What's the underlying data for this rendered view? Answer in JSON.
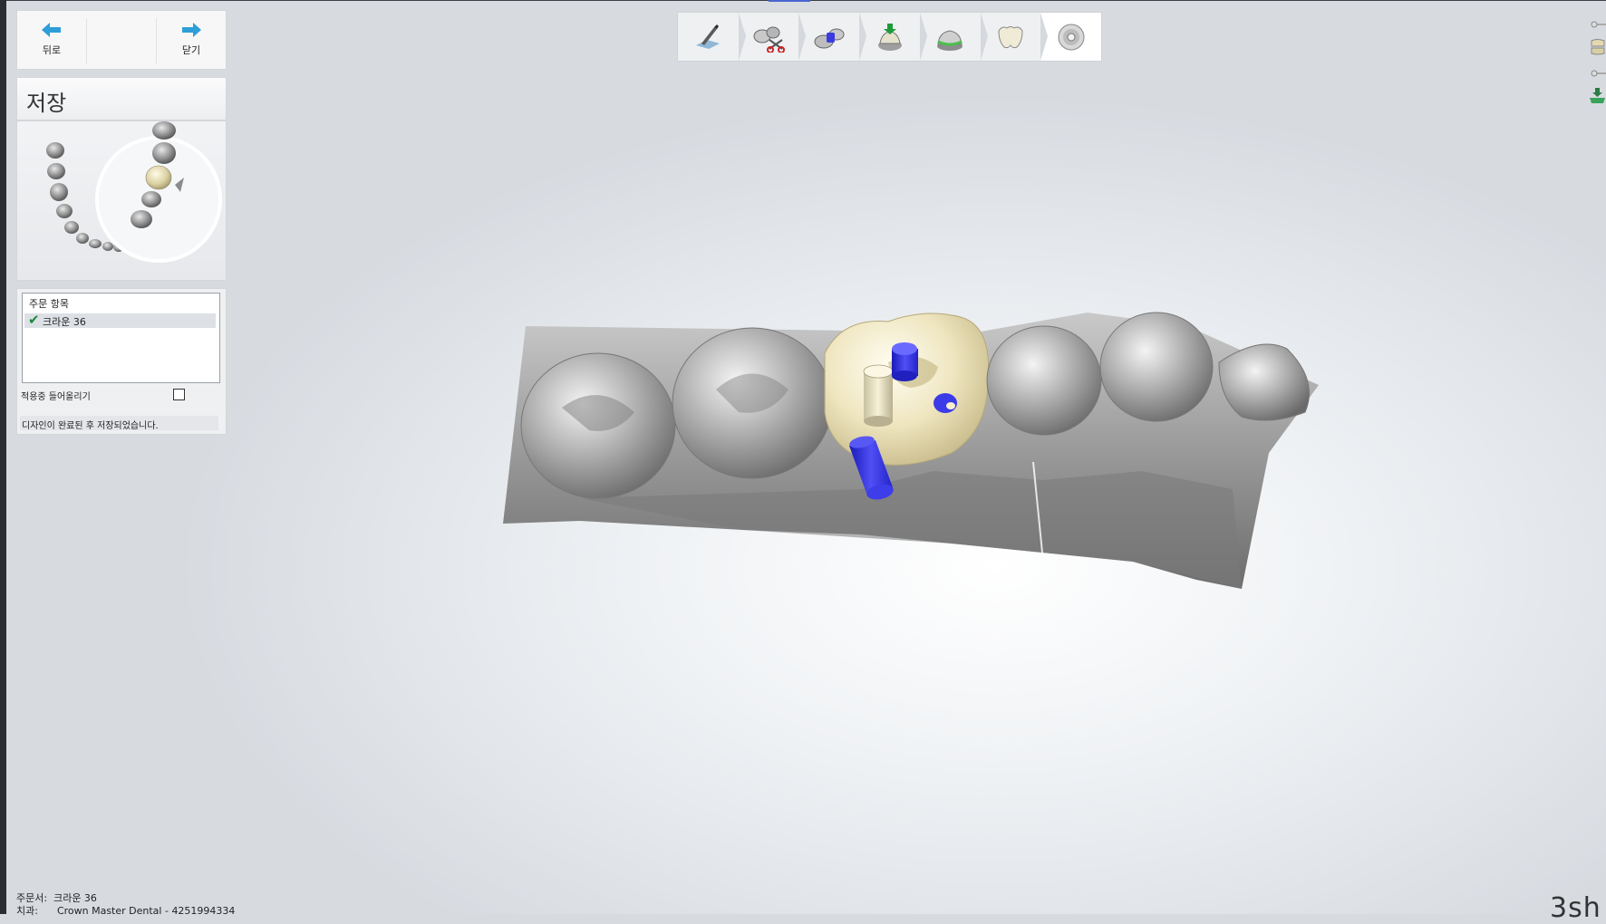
{
  "nav": {
    "back_label": "뒤로",
    "close_label": "닫기"
  },
  "step": {
    "title": "저장"
  },
  "order_panel": {
    "header": "주문 항목",
    "items": [
      {
        "label": "크라운 36",
        "checked": true
      }
    ],
    "option_label": "적용중 들어올리기",
    "option_checked": false,
    "status": "디자인이 완료된 후 저장되었습니다."
  },
  "toolbar": {
    "steps": [
      {
        "icon": "prepare-margin-icon"
      },
      {
        "icon": "scissors-trim-icon"
      },
      {
        "icon": "attachment-blocks-icon"
      },
      {
        "icon": "insertion-direction-icon"
      },
      {
        "icon": "cement-gap-icon"
      },
      {
        "icon": "crown-tooth-icon"
      },
      {
        "icon": "save-disc-icon",
        "active": true
      }
    ]
  },
  "right_icons": [
    "slider-handle-icon",
    "teeth-view-icon",
    "slider-handle-icon",
    "export-tray-icon"
  ],
  "footer": {
    "order_label": "주문서:",
    "order_value": "크라운 36",
    "lab_label": "치과:",
    "lab_value": "Crown Master Dental - 4251994334",
    "brand": "3sh"
  },
  "colors": {
    "accent_blue": "#2f9ed8",
    "crown": "#efe6c0",
    "model_gray": "#9a9a9a",
    "attachment_blue": "#2b2bdc"
  }
}
